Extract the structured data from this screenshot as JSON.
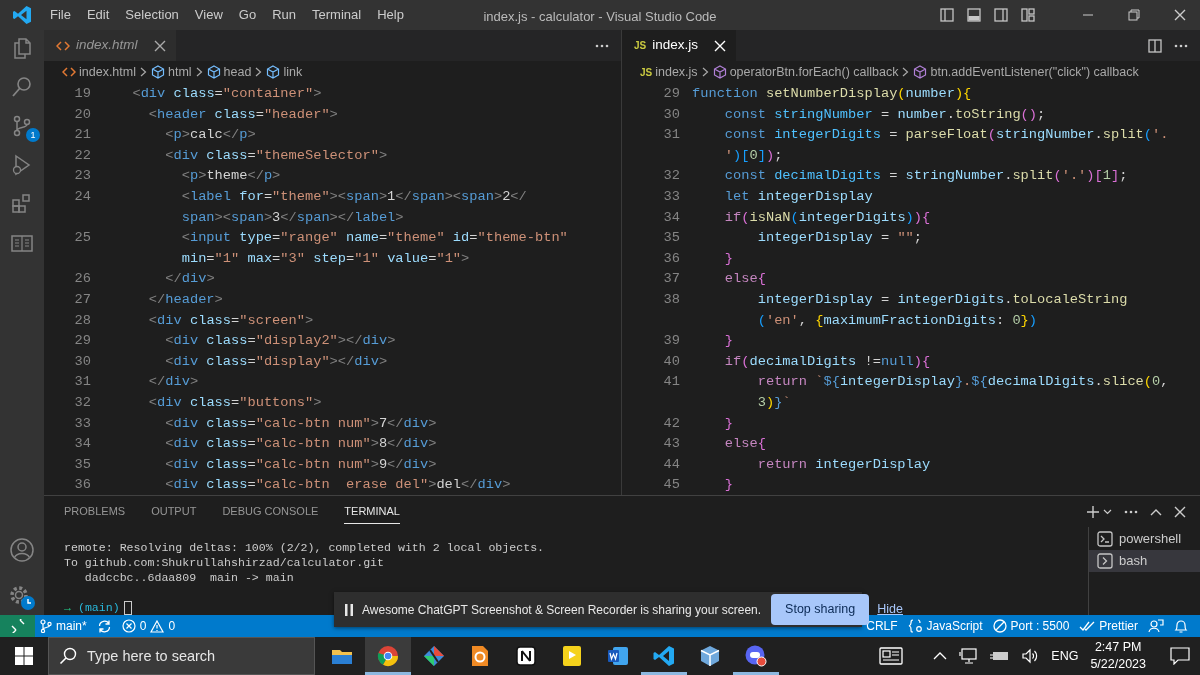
{
  "title_bar": {
    "menu": [
      "File",
      "Edit",
      "Selection",
      "View",
      "Go",
      "Run",
      "Terminal",
      "Help"
    ],
    "title": "index.js - calculator - Visual Studio Code"
  },
  "activity_bar": {
    "source_control_badge": "1"
  },
  "editor_groups": [
    {
      "tab": {
        "label": "index.html",
        "preview": true,
        "selected": false
      },
      "breadcrumbs": [
        {
          "kind": "html-file",
          "text": "index.html"
        },
        {
          "kind": "element",
          "text": "html"
        },
        {
          "kind": "element",
          "text": "head"
        },
        {
          "kind": "element",
          "text": "link"
        }
      ],
      "lines": [
        {
          "number": "19",
          "tokens": [
            {
              "kind": "p",
              "text": "  <"
            },
            {
              "kind": "tg",
              "text": "div"
            },
            {
              "kind": "at",
              "text": " class"
            },
            {
              "kind": "tx",
              "text": "="
            },
            {
              "kind": "s",
              "text": "\"container\""
            },
            {
              "kind": "p",
              "text": ">"
            }
          ]
        },
        {
          "number": "20",
          "tokens": [
            {
              "kind": "p",
              "text": "    <"
            },
            {
              "kind": "tg",
              "text": "header"
            },
            {
              "kind": "at",
              "text": " class"
            },
            {
              "kind": "tx",
              "text": "="
            },
            {
              "kind": "s",
              "text": "\"header\""
            },
            {
              "kind": "p",
              "text": ">"
            }
          ]
        },
        {
          "number": "21",
          "tokens": [
            {
              "kind": "p",
              "text": "      <"
            },
            {
              "kind": "tg",
              "text": "p"
            },
            {
              "kind": "p",
              "text": ">"
            },
            {
              "kind": "tx",
              "text": "calc"
            },
            {
              "kind": "p",
              "text": "</"
            },
            {
              "kind": "tg",
              "text": "p"
            },
            {
              "kind": "p",
              "text": ">"
            }
          ]
        },
        {
          "number": "22",
          "tokens": [
            {
              "kind": "p",
              "text": "      <"
            },
            {
              "kind": "tg",
              "text": "div"
            },
            {
              "kind": "at",
              "text": " class"
            },
            {
              "kind": "tx",
              "text": "="
            },
            {
              "kind": "s",
              "text": "\"themeSelector\""
            },
            {
              "kind": "p",
              "text": ">"
            }
          ]
        },
        {
          "number": "23",
          "tokens": [
            {
              "kind": "p",
              "text": "        <"
            },
            {
              "kind": "tg",
              "text": "p"
            },
            {
              "kind": "p",
              "text": ">"
            },
            {
              "kind": "tx",
              "text": "theme"
            },
            {
              "kind": "p",
              "text": "</"
            },
            {
              "kind": "tg",
              "text": "p"
            },
            {
              "kind": "p",
              "text": ">"
            }
          ]
        },
        {
          "number": "24",
          "tokens": [
            {
              "kind": "p",
              "text": "        <"
            },
            {
              "kind": "tg",
              "text": "label"
            },
            {
              "kind": "at",
              "text": " for"
            },
            {
              "kind": "tx",
              "text": "="
            },
            {
              "kind": "s",
              "text": "\"theme\""
            },
            {
              "kind": "p",
              "text": "><"
            },
            {
              "kind": "tg",
              "text": "span"
            },
            {
              "kind": "p",
              "text": ">"
            },
            {
              "kind": "tx",
              "text": "1"
            },
            {
              "kind": "p",
              "text": "</"
            },
            {
              "kind": "tg",
              "text": "span"
            },
            {
              "kind": "p",
              "text": "><"
            },
            {
              "kind": "tg",
              "text": "span"
            },
            {
              "kind": "p",
              "text": ">"
            },
            {
              "kind": "tx",
              "text": "2"
            },
            {
              "kind": "p",
              "text": "</"
            }
          ]
        },
        {
          "tokens": [
            {
              "kind": "tg",
              "text": "        span"
            },
            {
              "kind": "p",
              "text": "><"
            },
            {
              "kind": "tg",
              "text": "span"
            },
            {
              "kind": "p",
              "text": ">"
            },
            {
              "kind": "tx",
              "text": "3"
            },
            {
              "kind": "p",
              "text": "</"
            },
            {
              "kind": "tg",
              "text": "span"
            },
            {
              "kind": "p",
              "text": "></"
            },
            {
              "kind": "tg",
              "text": "label"
            },
            {
              "kind": "p",
              "text": ">"
            }
          ]
        },
        {
          "number": "25",
          "tokens": [
            {
              "kind": "p",
              "text": "        <"
            },
            {
              "kind": "tg",
              "text": "input"
            },
            {
              "kind": "at",
              "text": " type"
            },
            {
              "kind": "tx",
              "text": "="
            },
            {
              "kind": "s",
              "text": "\"range\""
            },
            {
              "kind": "at",
              "text": " name"
            },
            {
              "kind": "tx",
              "text": "="
            },
            {
              "kind": "s",
              "text": "\"theme\""
            },
            {
              "kind": "at",
              "text": " id"
            },
            {
              "kind": "tx",
              "text": "="
            },
            {
              "kind": "s",
              "text": "\"theme-btn\""
            }
          ]
        },
        {
          "tokens": [
            {
              "kind": "at",
              "text": "        min"
            },
            {
              "kind": "tx",
              "text": "="
            },
            {
              "kind": "s",
              "text": "\"1\""
            },
            {
              "kind": "at",
              "text": " max"
            },
            {
              "kind": "tx",
              "text": "="
            },
            {
              "kind": "s",
              "text": "\"3\""
            },
            {
              "kind": "at",
              "text": " step"
            },
            {
              "kind": "tx",
              "text": "="
            },
            {
              "kind": "s",
              "text": "\"1\""
            },
            {
              "kind": "at",
              "text": " value"
            },
            {
              "kind": "tx",
              "text": "="
            },
            {
              "kind": "s",
              "text": "\"1\""
            },
            {
              "kind": "p",
              "text": ">"
            }
          ]
        },
        {
          "number": "26",
          "tokens": [
            {
              "kind": "p",
              "text": "      </"
            },
            {
              "kind": "tg",
              "text": "div"
            },
            {
              "kind": "p",
              "text": ">"
            }
          ]
        },
        {
          "number": "27",
          "tokens": [
            {
              "kind": "p",
              "text": "    </"
            },
            {
              "kind": "tg",
              "text": "header"
            },
            {
              "kind": "p",
              "text": ">"
            }
          ]
        },
        {
          "number": "28",
          "tokens": [
            {
              "kind": "p",
              "text": "    <"
            },
            {
              "kind": "tg",
              "text": "div"
            },
            {
              "kind": "at",
              "text": " class"
            },
            {
              "kind": "tx",
              "text": "="
            },
            {
              "kind": "s",
              "text": "\"screen\""
            },
            {
              "kind": "p",
              "text": ">"
            }
          ]
        },
        {
          "number": "29",
          "tokens": [
            {
              "kind": "p",
              "text": "      <"
            },
            {
              "kind": "tg",
              "text": "div"
            },
            {
              "kind": "at",
              "text": " class"
            },
            {
              "kind": "tx",
              "text": "="
            },
            {
              "kind": "s",
              "text": "\"display2\""
            },
            {
              "kind": "p",
              "text": "></"
            },
            {
              "kind": "tg",
              "text": "div"
            },
            {
              "kind": "p",
              "text": ">"
            }
          ]
        },
        {
          "number": "30",
          "tokens": [
            {
              "kind": "p",
              "text": "      <"
            },
            {
              "kind": "tg",
              "text": "div"
            },
            {
              "kind": "at",
              "text": " class"
            },
            {
              "kind": "tx",
              "text": "="
            },
            {
              "kind": "s",
              "text": "\"display\""
            },
            {
              "kind": "p",
              "text": "></"
            },
            {
              "kind": "tg",
              "text": "div"
            },
            {
              "kind": "p",
              "text": ">"
            }
          ]
        },
        {
          "number": "31",
          "tokens": [
            {
              "kind": "p",
              "text": "    </"
            },
            {
              "kind": "tg",
              "text": "div"
            },
            {
              "kind": "p",
              "text": ">"
            }
          ]
        },
        {
          "number": "32",
          "tokens": [
            {
              "kind": "p",
              "text": "    <"
            },
            {
              "kind": "tg",
              "text": "div"
            },
            {
              "kind": "at",
              "text": " class"
            },
            {
              "kind": "tx",
              "text": "="
            },
            {
              "kind": "s",
              "text": "\"buttons\""
            },
            {
              "kind": "p",
              "text": ">"
            }
          ]
        },
        {
          "number": "33",
          "tokens": [
            {
              "kind": "p",
              "text": "      <"
            },
            {
              "kind": "tg",
              "text": "div"
            },
            {
              "kind": "at",
              "text": " class"
            },
            {
              "kind": "tx",
              "text": "="
            },
            {
              "kind": "s",
              "text": "\"calc-btn num\""
            },
            {
              "kind": "p",
              "text": ">"
            },
            {
              "kind": "tx",
              "text": "7"
            },
            {
              "kind": "p",
              "text": "</"
            },
            {
              "kind": "tg",
              "text": "div"
            },
            {
              "kind": "p",
              "text": ">"
            }
          ]
        },
        {
          "number": "34",
          "tokens": [
            {
              "kind": "p",
              "text": "      <"
            },
            {
              "kind": "tg",
              "text": "div"
            },
            {
              "kind": "at",
              "text": " class"
            },
            {
              "kind": "tx",
              "text": "="
            },
            {
              "kind": "s",
              "text": "\"calc-btn num\""
            },
            {
              "kind": "p",
              "text": ">"
            },
            {
              "kind": "tx",
              "text": "8"
            },
            {
              "kind": "p",
              "text": "</"
            },
            {
              "kind": "tg",
              "text": "div"
            },
            {
              "kind": "p",
              "text": ">"
            }
          ]
        },
        {
          "number": "35",
          "tokens": [
            {
              "kind": "p",
              "text": "      <"
            },
            {
              "kind": "tg",
              "text": "div"
            },
            {
              "kind": "at",
              "text": " class"
            },
            {
              "kind": "tx",
              "text": "="
            },
            {
              "kind": "s",
              "text": "\"calc-btn num\""
            },
            {
              "kind": "p",
              "text": ">"
            },
            {
              "kind": "tx",
              "text": "9"
            },
            {
              "kind": "p",
              "text": "</"
            },
            {
              "kind": "tg",
              "text": "div"
            },
            {
              "kind": "p",
              "text": ">"
            }
          ]
        },
        {
          "number": "36",
          "tokens": [
            {
              "kind": "p",
              "text": "      <"
            },
            {
              "kind": "tg",
              "text": "div"
            },
            {
              "kind": "at",
              "text": " class"
            },
            {
              "kind": "tx",
              "text": "="
            },
            {
              "kind": "s",
              "text": "\"calc-btn  erase del\""
            },
            {
              "kind": "p",
              "text": ">"
            },
            {
              "kind": "tx",
              "text": "del"
            },
            {
              "kind": "p",
              "text": "</"
            },
            {
              "kind": "tg",
              "text": "div"
            },
            {
              "kind": "p",
              "text": ">"
            }
          ]
        }
      ]
    },
    {
      "tab": {
        "label": "index.js",
        "badge": "JS",
        "preview": false,
        "selected": true
      },
      "breadcrumbs": [
        {
          "kind": "js-file",
          "badge": "JS",
          "text": "index.js"
        },
        {
          "kind": "method",
          "text": "operatorBtn.forEach() callback"
        },
        {
          "kind": "method",
          "text": "btn.addEventListener(\"click\") callback"
        }
      ],
      "lines": [
        {
          "number": "29",
          "tokens": [
            {
              "kind": "kw",
              "text": "function"
            },
            {
              "kind": "fn",
              "text": " setNumberDisplay"
            },
            {
              "kind": "b1",
              "text": "("
            },
            {
              "kind": "v",
              "text": "number"
            },
            {
              "kind": "b1",
              "text": "){"
            }
          ]
        },
        {
          "number": "30",
          "tokens": [
            {
              "kind": "kw",
              "text": "    const"
            },
            {
              "kind": "c",
              "text": " stringNumber"
            },
            {
              "kind": "tx",
              "text": " = "
            },
            {
              "kind": "v",
              "text": "number"
            },
            {
              "kind": "tx",
              "text": "."
            },
            {
              "kind": "fn",
              "text": "toString"
            },
            {
              "kind": "b2",
              "text": "()"
            },
            {
              "kind": "tx",
              "text": ";"
            }
          ]
        },
        {
          "number": "31",
          "tokens": [
            {
              "kind": "kw",
              "text": "    const"
            },
            {
              "kind": "c",
              "text": " integerDigits"
            },
            {
              "kind": "tx",
              "text": " = "
            },
            {
              "kind": "fn",
              "text": "parseFloat"
            },
            {
              "kind": "b2",
              "text": "("
            },
            {
              "kind": "v",
              "text": "stringNumber"
            },
            {
              "kind": "tx",
              "text": "."
            },
            {
              "kind": "fn",
              "text": "split"
            },
            {
              "kind": "b3",
              "text": "("
            },
            {
              "kind": "s",
              "text": "'."
            }
          ]
        },
        {
          "tokens": [
            {
              "kind": "s",
              "text": "    '"
            },
            {
              "kind": "b3",
              "text": ")"
            },
            {
              "kind": "b3",
              "text": "["
            },
            {
              "kind": "n",
              "text": "0"
            },
            {
              "kind": "b3",
              "text": "]"
            },
            {
              "kind": "b2",
              "text": ")"
            },
            {
              "kind": "tx",
              "text": ";"
            }
          ]
        },
        {
          "number": "32",
          "tokens": [
            {
              "kind": "kw",
              "text": "    const"
            },
            {
              "kind": "c",
              "text": " decimalDigits"
            },
            {
              "kind": "tx",
              "text": " = "
            },
            {
              "kind": "v",
              "text": "stringNumber"
            },
            {
              "kind": "tx",
              "text": "."
            },
            {
              "kind": "fn",
              "text": "split"
            },
            {
              "kind": "b2",
              "text": "("
            },
            {
              "kind": "s",
              "text": "'.'"
            },
            {
              "kind": "b2",
              "text": ")["
            },
            {
              "kind": "n",
              "text": "1"
            },
            {
              "kind": "b2",
              "text": "]"
            },
            {
              "kind": "tx",
              "text": ";"
            }
          ]
        },
        {
          "number": "33",
          "tokens": [
            {
              "kind": "kw",
              "text": "    let"
            },
            {
              "kind": "v",
              "text": " integerDisplay"
            }
          ]
        },
        {
          "number": "34",
          "tokens": [
            {
              "kind": "ct",
              "text": "    if"
            },
            {
              "kind": "b2",
              "text": "("
            },
            {
              "kind": "fn",
              "text": "isNaN"
            },
            {
              "kind": "b3",
              "text": "("
            },
            {
              "kind": "v",
              "text": "integerDigits"
            },
            {
              "kind": "b3",
              "text": ")"
            },
            {
              "kind": "b2",
              "text": "){"
            }
          ]
        },
        {
          "number": "35",
          "tokens": [
            {
              "kind": "v",
              "text": "        integerDisplay"
            },
            {
              "kind": "tx",
              "text": " = "
            },
            {
              "kind": "s",
              "text": "\"\""
            },
            {
              "kind": "tx",
              "text": ";"
            }
          ]
        },
        {
          "number": "36",
          "tokens": [
            {
              "kind": "b2",
              "text": "    }"
            }
          ]
        },
        {
          "number": "37",
          "tokens": [
            {
              "kind": "ct",
              "text": "    else"
            },
            {
              "kind": "b2",
              "text": "{"
            }
          ]
        },
        {
          "number": "38",
          "tokens": [
            {
              "kind": "v",
              "text": "        integerDisplay"
            },
            {
              "kind": "tx",
              "text": " = "
            },
            {
              "kind": "v",
              "text": "integerDigits"
            },
            {
              "kind": "tx",
              "text": "."
            },
            {
              "kind": "fn",
              "text": "toLocaleString"
            }
          ]
        },
        {
          "tokens": [
            {
              "kind": "b3",
              "text": "        ("
            },
            {
              "kind": "s",
              "text": "'en'"
            },
            {
              "kind": "tx",
              "text": ", "
            },
            {
              "kind": "b1",
              "text": "{"
            },
            {
              "kind": "v",
              "text": "maximumFractionDigits"
            },
            {
              "kind": "tx",
              "text": ": "
            },
            {
              "kind": "n",
              "text": "0"
            },
            {
              "kind": "b1",
              "text": "}"
            },
            {
              "kind": "b3",
              "text": ")"
            }
          ]
        },
        {
          "number": "39",
          "tokens": [
            {
              "kind": "b2",
              "text": "    }"
            }
          ]
        },
        {
          "number": "40",
          "tokens": [
            {
              "kind": "ct",
              "text": "    if"
            },
            {
              "kind": "b2",
              "text": "("
            },
            {
              "kind": "v",
              "text": "decimalDigits"
            },
            {
              "kind": "tx",
              "text": " !="
            },
            {
              "kind": "kw",
              "text": "null"
            },
            {
              "kind": "b2",
              "text": "){"
            }
          ]
        },
        {
          "number": "41",
          "tokens": [
            {
              "kind": "ct",
              "text": "        return"
            },
            {
              "kind": "s",
              "text": " `"
            },
            {
              "kind": "kw",
              "text": "${"
            },
            {
              "kind": "v",
              "text": "integerDisplay"
            },
            {
              "kind": "kw",
              "text": "}"
            },
            {
              "kind": "s",
              "text": "."
            },
            {
              "kind": "kw",
              "text": "${"
            },
            {
              "kind": "v",
              "text": "decimalDigits"
            },
            {
              "kind": "tx",
              "text": "."
            },
            {
              "kind": "fn",
              "text": "slice"
            },
            {
              "kind": "b1",
              "text": "("
            },
            {
              "kind": "n",
              "text": "0"
            },
            {
              "kind": "tx",
              "text": ","
            }
          ]
        },
        {
          "tokens": [
            {
              "kind": "n",
              "text": "        3"
            },
            {
              "kind": "b1",
              "text": ")"
            },
            {
              "kind": "kw",
              "text": "}"
            },
            {
              "kind": "s",
              "text": "`"
            }
          ]
        },
        {
          "number": "42",
          "tokens": [
            {
              "kind": "b2",
              "text": "    }"
            }
          ]
        },
        {
          "number": "43",
          "tokens": [
            {
              "kind": "ct",
              "text": "    else"
            },
            {
              "kind": "b2",
              "text": "{"
            }
          ]
        },
        {
          "number": "44",
          "tokens": [
            {
              "kind": "ct",
              "text": "        return"
            },
            {
              "kind": "v",
              "text": " integerDisplay"
            }
          ]
        },
        {
          "number": "45",
          "tokens": [
            {
              "kind": "b2",
              "text": "    }"
            }
          ]
        }
      ]
    }
  ],
  "panel": {
    "tabs": [
      {
        "label": "PROBLEMS",
        "selected": false
      },
      {
        "label": "OUTPUT",
        "selected": false
      },
      {
        "label": "DEBUG CONSOLE",
        "selected": false
      },
      {
        "label": "TERMINAL",
        "selected": true
      }
    ],
    "terminal_lines": [
      {
        "kind": "output",
        "text": "remote: Resolving deltas: 100% (2/2), completed with 2 local objects."
      },
      {
        "kind": "output",
        "text": "To github.com:Shukrullahshirzad/calculator.git"
      },
      {
        "kind": "output",
        "text": "   dadccbc..6daa809  main -> main"
      },
      {
        "kind": "prompt",
        "arrow": "→",
        "branch": "(main)"
      }
    ],
    "terminals": [
      {
        "kind": "powershell",
        "label": "powershell",
        "selected": false
      },
      {
        "kind": "bash",
        "label": "bash",
        "selected": true
      }
    ]
  },
  "status_bar": {
    "branch": "main*",
    "errors": "0",
    "warnings": "0",
    "right_items": [
      {
        "kind": "text",
        "text": "CRLF"
      },
      {
        "kind": "language",
        "text": "JavaScript"
      },
      {
        "kind": "port",
        "text": "Port : 5500"
      },
      {
        "kind": "formatter",
        "text": "Prettier"
      },
      {
        "kind": "feedback"
      },
      {
        "kind": "bell"
      }
    ]
  },
  "notification": {
    "message": "Awesome ChatGPT Screenshot & Screen Recorder is sharing your screen.",
    "button": "Stop sharing",
    "link": "Hide"
  },
  "taskbar": {
    "search_placeholder": "Type here to search",
    "apps": [
      {
        "running": false,
        "selected": false
      },
      {
        "running": true,
        "selected": true
      },
      {
        "running": false,
        "selected": false
      },
      {
        "running": false,
        "selected": false
      },
      {
        "running": false,
        "selected": false
      },
      {
        "running": false,
        "selected": false
      },
      {
        "running": false,
        "selected": false
      },
      {
        "running": true,
        "selected": false
      },
      {
        "running": false,
        "selected": false
      },
      {
        "running": true,
        "selected": false
      }
    ],
    "language": "ENG",
    "time": "2:47 PM",
    "date": "5/22/2023"
  }
}
